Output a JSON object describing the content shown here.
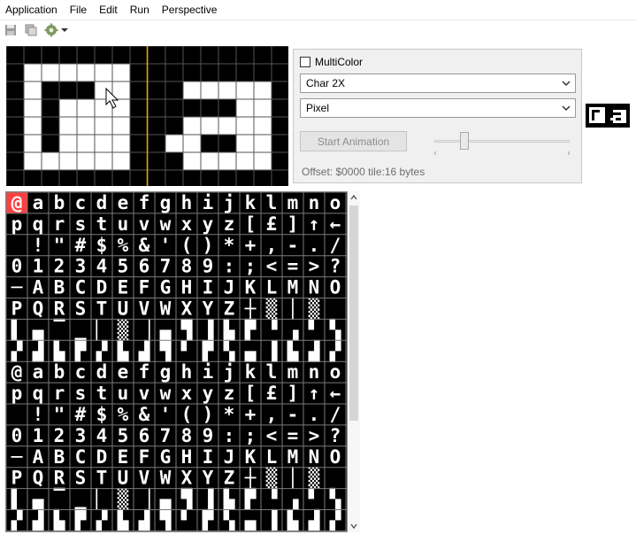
{
  "menubar": {
    "items": [
      "Application",
      "File",
      "Edit",
      "Run",
      "Perspective"
    ]
  },
  "toolbar": {
    "buttons": [
      "save-icon",
      "copy-icon",
      "settings-gear-icon"
    ],
    "dropdown": "chevron-down-icon"
  },
  "editor": {
    "mode": "Char 2X",
    "cursor": "arrow-cursor-icon",
    "colors": {
      "pixel_on": "#ffffff",
      "pixel_off": "#000000",
      "grid": "#555555",
      "divider": "#e8a200"
    }
  },
  "properties": {
    "multicolor_label": "MultiColor",
    "multicolor_checked": false,
    "view_mode_value": "Char 2X",
    "draw_mode_value": "Pixel",
    "start_animation_label": "Start Animation",
    "speed_level": 0.2,
    "offset_text": "Offset: $0000 tile:16 bytes"
  },
  "charset": {
    "selected_color": "#ff4040",
    "rows": [
      "@abcdefghijklmno",
      "pqrstuvwxyz[£]↑←",
      " !\"#$%&'()*+,-./",
      "0123456789:;<=>?",
      "─ABCDEFGHIJKLMNO",
      "PQRSTUVWXYZ┼▒│▒",
      "▌▄▔▁▏▒▕▄▜▐▙▛▝▗▘▚",
      "▞▟▙▛▞▙▟▜▘▛▚▄▐▙▟▞",
      "@abcdefghijklmno",
      "pqrstuvwxyz[£]↑←",
      " !\"#$%&'()*+,-./",
      "0123456789:;<=>?",
      "─ABCDEFGHIJKLMNO",
      "PQRSTUVWXYZ┼▒│▒",
      "▌▄▔▁▏▒▕▄▜▐▙▛▝▗▘▚",
      "▞▟▙▛▞▙▟▜▘▛▚▄▐▙▟▞"
    ]
  }
}
